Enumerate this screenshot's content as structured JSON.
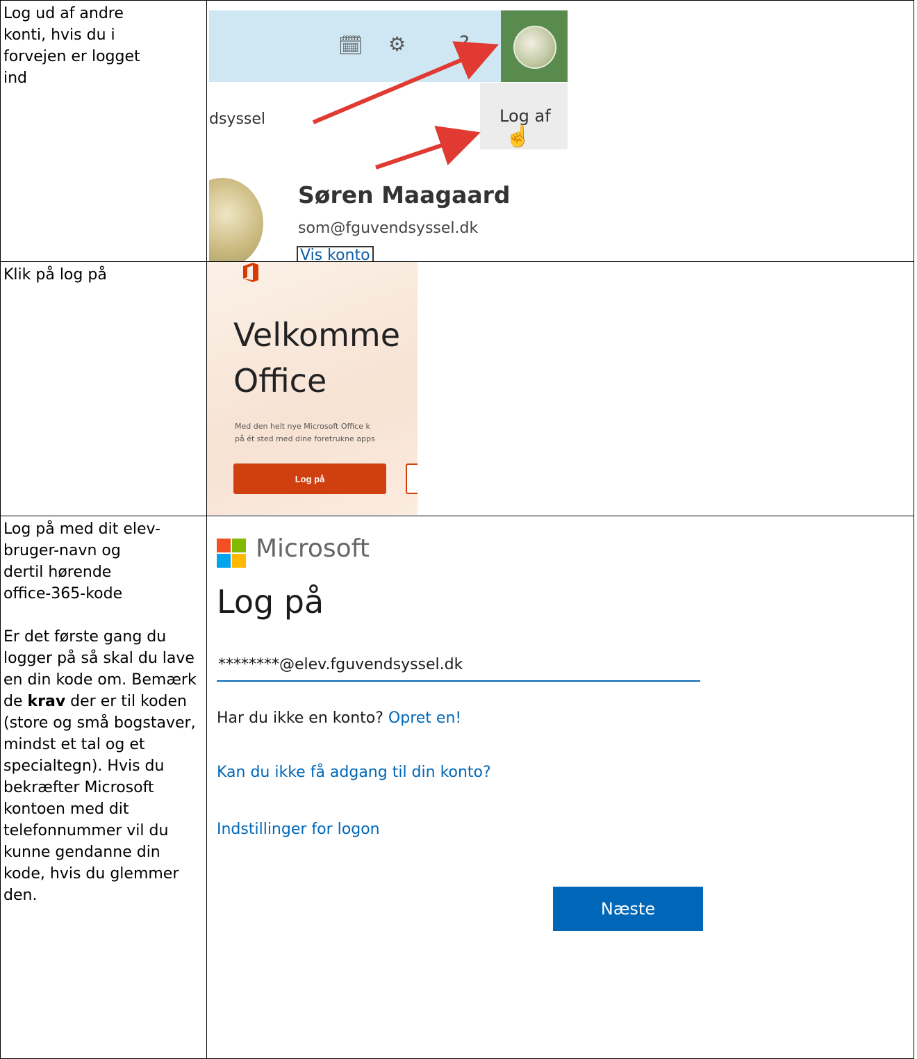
{
  "rows": [
    {
      "label": [
        "Log ud af andre",
        "konti, hvis du i",
        "forvejen er logget",
        "ind"
      ]
    },
    {
      "label": [
        "Klik på log på"
      ]
    },
    {
      "label": [
        "Log på med dit elev-",
        "bruger-navn og",
        "dertil hørende",
        "office-365-kode"
      ],
      "label2_before": "Er det første gang du logger på så skal du lave en din kode om. Bemærk de ",
      "label2_bold": "krav",
      "label2_after": " der er til koden (store og små bogstaver, mindst et tal og et specialtegn). Hvis du bekræfter Microsoft kontoen med dit telefonnummer vil du kunne gendanne din kode, hvis du glemmer den."
    }
  ],
  "shot1": {
    "org_fragment": "dsyssel",
    "signout": "Log af",
    "name": "Søren Maagaard",
    "email": "som@fguvendsyssel.dk",
    "view_account": "Vis konto",
    "icons": [
      "calendar-check-icon",
      "gear-icon",
      "help-icon",
      "avatar"
    ],
    "arrow_color": "#e03a32"
  },
  "shot2": {
    "title_line1": "Velkomme",
    "title_line2": "Office",
    "desc_line1": "Med den helt nye Microsoft Office k",
    "desc_line2": "på ét sted med dine foretrukne apps",
    "button": "Log på",
    "accent": "#cf3f10"
  },
  "shot3": {
    "brand": "Microsoft",
    "title": "Log på",
    "email_value": "********@elev.fguvendsyssel.dk",
    "no_account": "Har du ikke en konto?",
    "create": "Opret en!",
    "cant_access": "Kan du ikke få adgang til din konto?",
    "signin_options": "Indstillinger for logon",
    "next": "Næste",
    "accent": "#0067b8"
  }
}
